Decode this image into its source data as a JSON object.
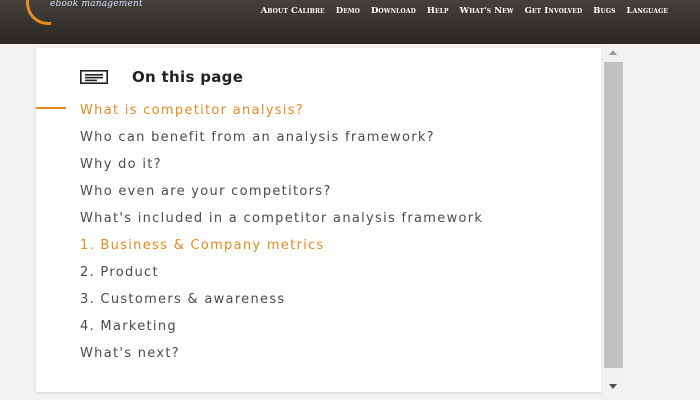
{
  "header": {
    "logo_text": "ebook management",
    "nav": [
      {
        "label": "About Calibre"
      },
      {
        "label": "Demo"
      },
      {
        "label": "Download"
      },
      {
        "label": "Help"
      },
      {
        "label": "What's New"
      },
      {
        "label": "Get Involved"
      },
      {
        "label": "Bugs"
      },
      {
        "label": "Language"
      }
    ]
  },
  "toc": {
    "title": "On this page",
    "icon": "list-icon",
    "active_color": "#e58a1f",
    "items": [
      {
        "label": "What is competitor analysis?"
      },
      {
        "label": "Who can benefit from an analysis framework?"
      },
      {
        "label": "Why do it?"
      },
      {
        "label": "Who even are your competitors?"
      },
      {
        "label": "What's included in a competitor analysis framework"
      },
      {
        "label": "1. Business & Company metrics"
      },
      {
        "label": "2. Product"
      },
      {
        "label": "3. Customers & awareness"
      },
      {
        "label": "4. Marketing"
      },
      {
        "label": "What's next?"
      }
    ]
  }
}
